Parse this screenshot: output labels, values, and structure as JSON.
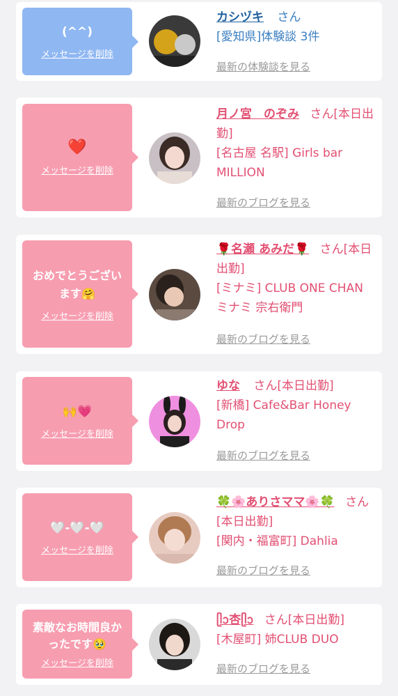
{
  "cards": [
    {
      "message": "(^^)",
      "delete_label": "メッセージを削除",
      "name": "カシヅキ",
      "suffix": "さん",
      "detail": "[愛知県]体験談 3件",
      "link": "最新の体験談を見る",
      "bubble_color": "#8fb7f2"
    },
    {
      "message": "❤️",
      "delete_label": "メッセージを削除",
      "name": "月ノ宮　のぞみ",
      "suffix": "さん[本日出勤]",
      "detail": "[名古屋 名駅] Girls bar MILLION",
      "link": "最新のブログを見る",
      "bubble_color": "#f79db0"
    },
    {
      "message": "おめでとうございます🤗",
      "delete_label": "メッセージを削除",
      "name": "🌹名瀬 あみだ🌹",
      "suffix": "さん[本日出勤]",
      "detail": "[ミナミ] CLUB ONE CHAN ミナミ 宗右衛門",
      "link": "最新のブログを見る",
      "bubble_color": "#f79db0"
    },
    {
      "message": "🙌💗",
      "delete_label": "メッセージを削除",
      "name": "ゆな",
      "suffix": "さん[本日出勤]",
      "detail": "[新橋] Cafe&Bar Honey Drop",
      "link": "最新のブログを見る",
      "bubble_color": "#f79db0"
    },
    {
      "message": "🤍-🤍-🤍",
      "delete_label": "メッセージを削除",
      "name": "🍀🌸ありさママ🌸🍀",
      "suffix": "さん[本日出勤]",
      "detail": "[関内・福富町] Dahlia",
      "link": "最新のブログを見る",
      "bubble_color": "#f79db0"
    },
    {
      "message": "素敵なお時間良かったです🥹",
      "delete_label": "メッセージを削除",
      "name": "ᥫᩣ杏ᥫᩣ",
      "suffix": "さん[本日出勤]",
      "detail": "[木屋町] 姉CLUB DUO",
      "link": "最新のブログを見る",
      "bubble_color": "#f79db0"
    }
  ]
}
